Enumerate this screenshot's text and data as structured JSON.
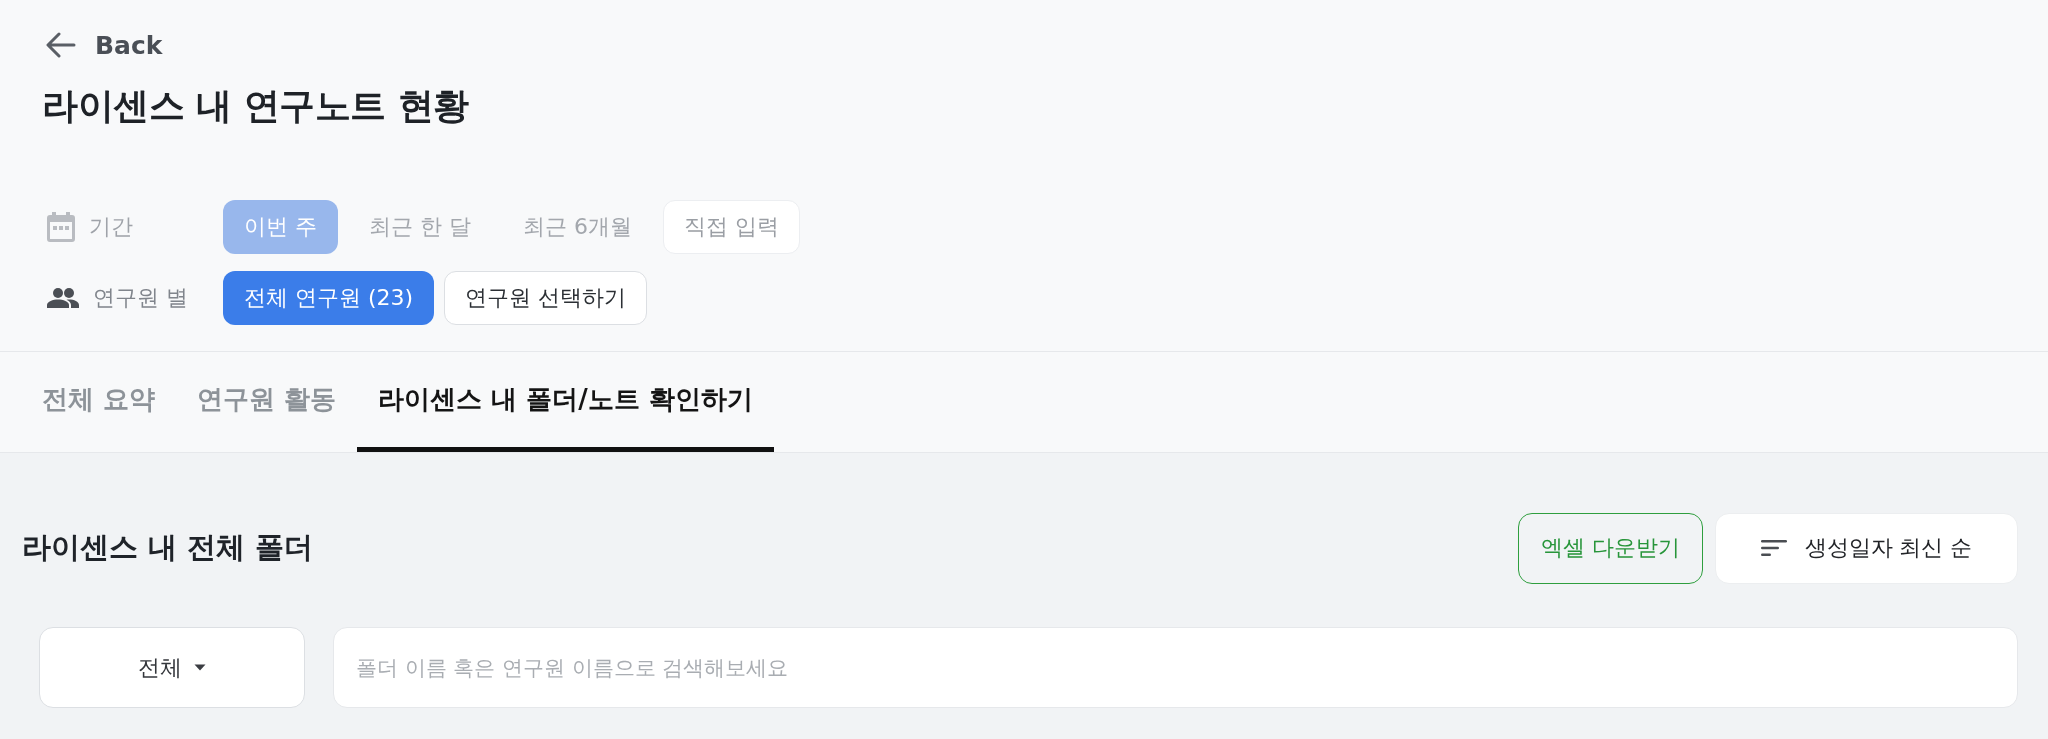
{
  "back": {
    "label": "Back"
  },
  "title": "라이센스 내 연구노트 현황",
  "filters": [
    {
      "kind": "period",
      "label": "기간",
      "disabled": true,
      "options": [
        {
          "label": "이번 주",
          "kind": "preset",
          "selected": true
        },
        {
          "label": "최근 한 달",
          "kind": "preset",
          "selected": false
        },
        {
          "label": "최근 6개월",
          "kind": "preset",
          "selected": false
        },
        {
          "label": "직접 입력",
          "kind": "action",
          "selected": false
        }
      ]
    },
    {
      "kind": "researcher",
      "label": "연구원 별",
      "disabled": false,
      "options": [
        {
          "label": "전체 연구원 (23)",
          "kind": "preset",
          "selected": true
        },
        {
          "label": "연구원 선택하기",
          "kind": "action",
          "selected": false
        }
      ]
    }
  ],
  "tabs": [
    {
      "label": "전체 요약",
      "selected": false
    },
    {
      "label": "연구원 활동",
      "selected": false
    },
    {
      "label": "라이센스 내 폴더/노트 확인하기",
      "selected": true
    }
  ],
  "section": {
    "title": "라이센스 내 전체 폴더",
    "excel_button": "엑셀 다운받기",
    "sort_button": "생성일자 최신 순"
  },
  "search": {
    "scope": "전체",
    "placeholder": "폴더 이름 혹은 연구원 이름으로 검색해보세요"
  }
}
